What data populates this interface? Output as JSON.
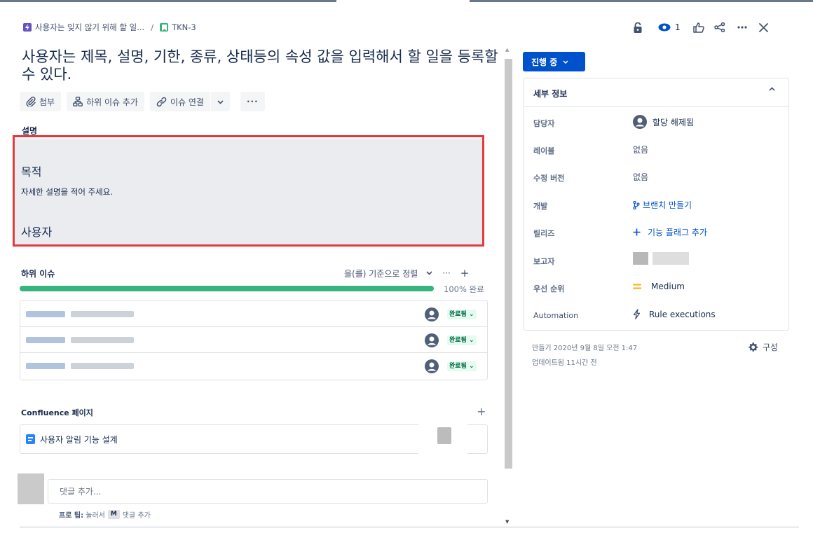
{
  "breadcrumb": {
    "epic": {
      "icon": "epic-lightning-icon",
      "label": "사용자는 잊지 않기 위해 할 일..."
    },
    "separator": "/",
    "issue": {
      "icon": "story-bookmark-icon",
      "label": "TKN-3"
    }
  },
  "header": {
    "watch_count": "1",
    "icons": [
      "lock-icon",
      "eye-icon",
      "thumbs-up-icon",
      "share-icon",
      "more-icon",
      "close-icon"
    ]
  },
  "issue": {
    "title": "사용자는 제목, 설명, 기한, 종류, 상태등의 속성 값을 입력해서 할 일을 등록할 수 있다."
  },
  "toolbar": {
    "attach": "첨부",
    "add_child": "하위 이슈 추가",
    "link_issue": "이슈 연결",
    "more": "···"
  },
  "description": {
    "label": "설명",
    "heading_1": "목적",
    "paragraph": "자세한 설명을 적어 주세요.",
    "heading_2": "사용자"
  },
  "child_issues": {
    "label": "하위 이슈",
    "sort_label": "을(를) 기준으로 정렬",
    "progress_percent": 100,
    "progress_label": "100% 완료",
    "items": [
      {
        "status": "완료됨"
      },
      {
        "status": "완료됨"
      },
      {
        "status": "완료됨"
      }
    ]
  },
  "confluence": {
    "label": "Confluence 페이지",
    "page_title": "사용자 알림 기능 설계"
  },
  "comment": {
    "placeholder": "댓글 추가...",
    "protip_label": "프로 팁:",
    "protip_text_1": "눌러서",
    "protip_key": "M",
    "protip_text_2": "댓글 추가"
  },
  "sidebar": {
    "status_button": "진행 중",
    "details": {
      "title": "세부 정보",
      "assignee_label": "담당자",
      "assignee_value": "할당 해제됨",
      "labels_label": "레이블",
      "labels_value": "없음",
      "fix_version_label": "수정 버전",
      "fix_version_value": "없음",
      "development_label": "개발",
      "development_value": "브랜치 만들기",
      "releases_label": "릴리즈",
      "releases_value": "기능 플래그 추가",
      "reporter_label": "보고자",
      "priority_label": "우선 순위",
      "priority_value": "Medium",
      "priority_color": "#FFAB00",
      "automation_label": "Automation",
      "automation_value": "Rule executions"
    },
    "created": "만들기 2020년 9월 8일 오전 1:47",
    "updated": "업데이트됨 11시간 전",
    "configure": "구성"
  },
  "colors": {
    "primary": "#0052CC",
    "done_green": "#36B37E",
    "highlight_red": "#E5383B"
  }
}
